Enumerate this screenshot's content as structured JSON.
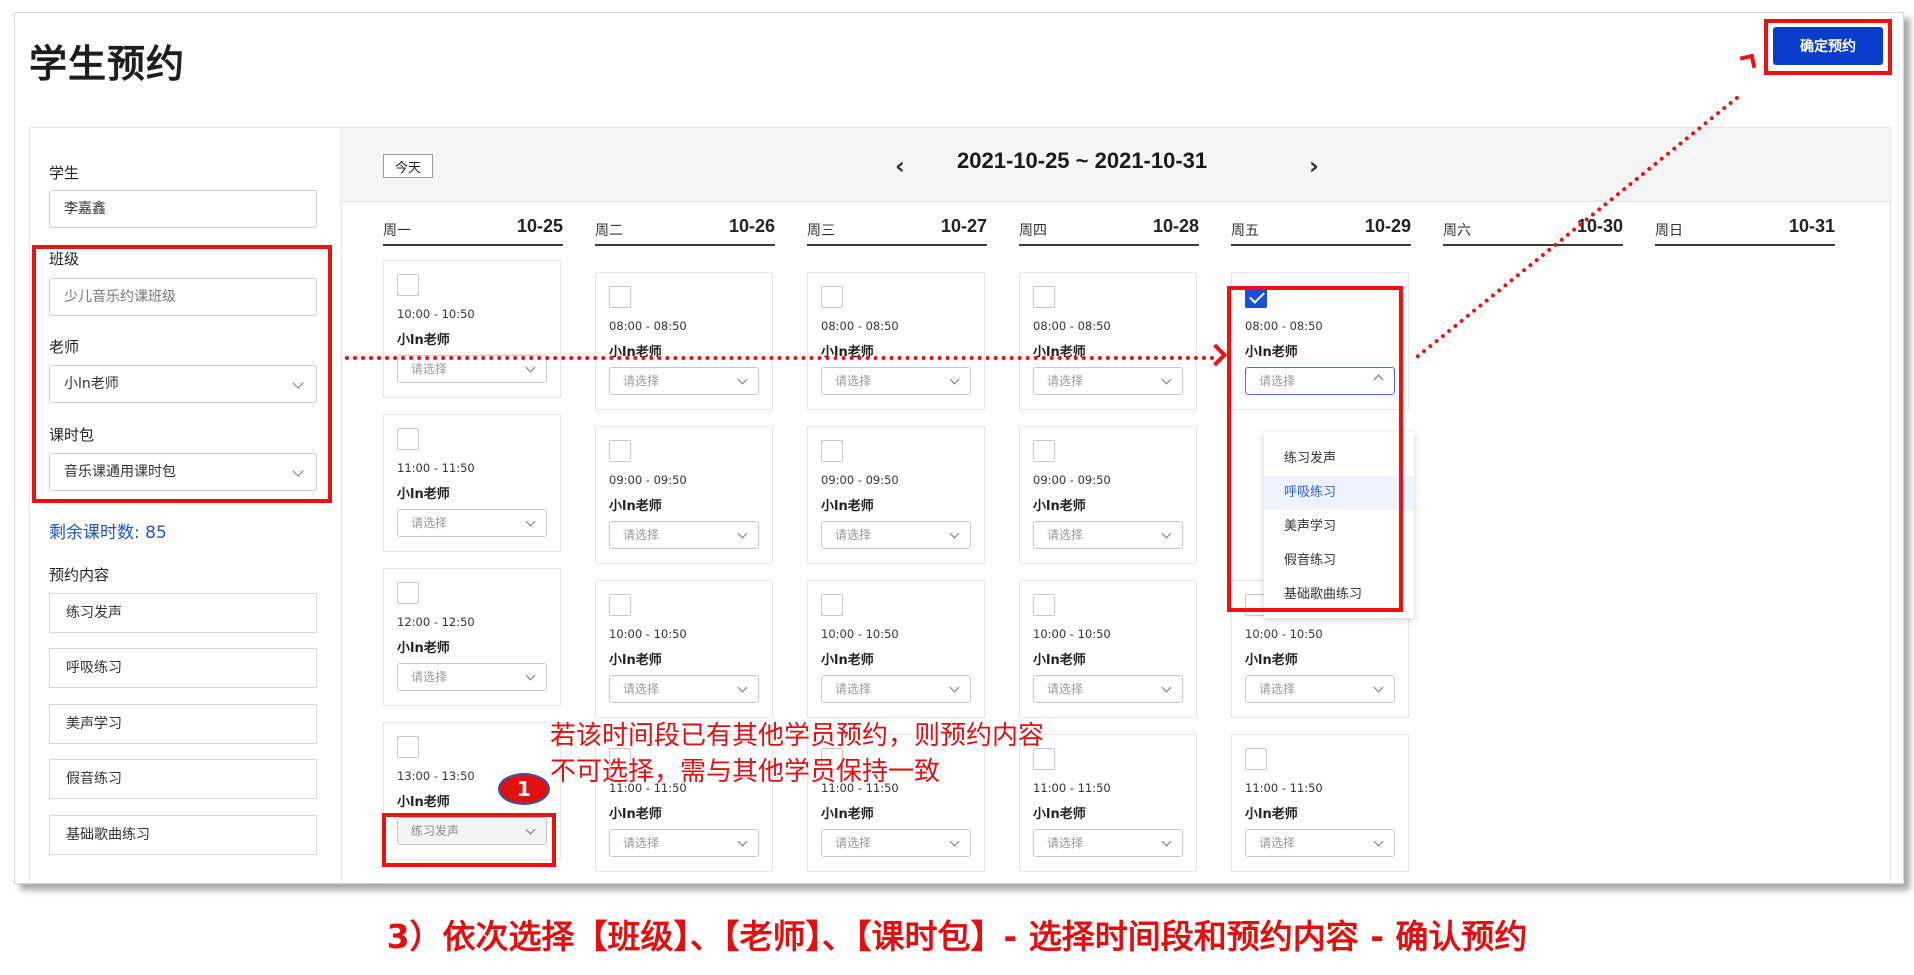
{
  "page": {
    "title": "学生预约",
    "confirm_label": "确定预约"
  },
  "sidebar": {
    "student_label": "学生",
    "student_value": "李嘉鑫",
    "class_label": "班级",
    "class_value": "少儿音乐约课班级",
    "teacher_label": "老师",
    "teacher_value": "小ln老师",
    "package_label": "课时包",
    "package_value": "音乐课通用课时包",
    "remaining": "剩余课时数: 85",
    "content_label": "预约内容",
    "content_items": [
      "练习发声",
      "呼吸练习",
      "美声学习",
      "假音练习",
      "基础歌曲练习"
    ]
  },
  "calendar": {
    "today_label": "今天",
    "prev_arrow": "‹",
    "next_arrow": "›",
    "date_range": "2021-10-25 ~ 2021-10-31",
    "days": [
      {
        "weekday": "周一",
        "date": "10-25"
      },
      {
        "weekday": "周二",
        "date": "10-26"
      },
      {
        "weekday": "周三",
        "date": "10-27"
      },
      {
        "weekday": "周四",
        "date": "10-28"
      },
      {
        "weekday": "周五",
        "date": "10-29"
      },
      {
        "weekday": "周六",
        "date": "10-30"
      },
      {
        "weekday": "周日",
        "date": "10-31"
      }
    ],
    "teacher": "小ln老师",
    "placeholder": "请选择",
    "mon_slots": [
      {
        "time": "10:00 - 10:50"
      },
      {
        "time": "11:00 - 11:50"
      },
      {
        "time": "12:00 - 12:50"
      },
      {
        "time": "13:00 - 13:50",
        "value": "练习发声"
      }
    ],
    "std_slots": [
      {
        "time": "08:00 - 08:50"
      },
      {
        "time": "09:00 - 09:50"
      },
      {
        "time": "10:00 - 10:50"
      },
      {
        "time": "11:00 - 11:50"
      }
    ],
    "fri_slots": [
      {
        "time": "08:00 - 08:50",
        "checked": true
      },
      {
        "time": "10:00 - 10:50"
      },
      {
        "time": "11:00 - 11:50"
      }
    ],
    "dropdown_options": [
      "练习发声",
      "呼吸练习",
      "美声学习",
      "假音练习",
      "基础歌曲练习"
    ],
    "dropdown_highlight": "呼吸练习"
  },
  "annotation": {
    "line1": "若该时间段已有其他学员预约，则预约内容",
    "line2": "不可选择，需与其他学员保持一致",
    "badge": "1"
  },
  "footer": "3）依次选择【班级】、【老师】、【课时包】- 选择时间段和预约内容 - 确认预约",
  "colors": {
    "primary": "#0a3dcc",
    "annotation_red": "#e01010",
    "link_blue": "#1f55c8"
  }
}
